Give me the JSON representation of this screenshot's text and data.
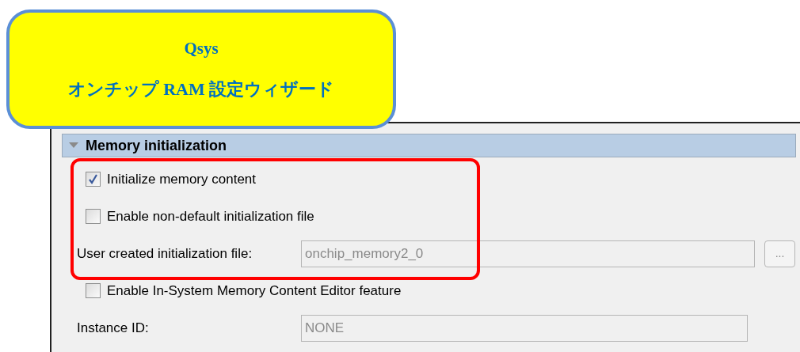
{
  "callout": {
    "title": "Qsys",
    "subtitle": "オンチップ RAM 設定ウィザード"
  },
  "section": {
    "title": "Memory initialization",
    "expanded": true
  },
  "highlighted_options": [
    {
      "kind": "checkbox",
      "label": "Initialize memory content",
      "checked": true
    },
    {
      "kind": "checkbox",
      "label": "Enable non-default initialization file",
      "checked": false
    },
    {
      "kind": "file",
      "label": "User created initialization file:",
      "value": "onchip_memory2_0",
      "disabled": true,
      "browse": "..."
    }
  ],
  "options": [
    {
      "kind": "checkbox",
      "label": "Enable In-System Memory Content Editor feature",
      "checked": false
    },
    {
      "kind": "text",
      "label": "Instance ID:",
      "value": "NONE",
      "disabled": true
    }
  ]
}
